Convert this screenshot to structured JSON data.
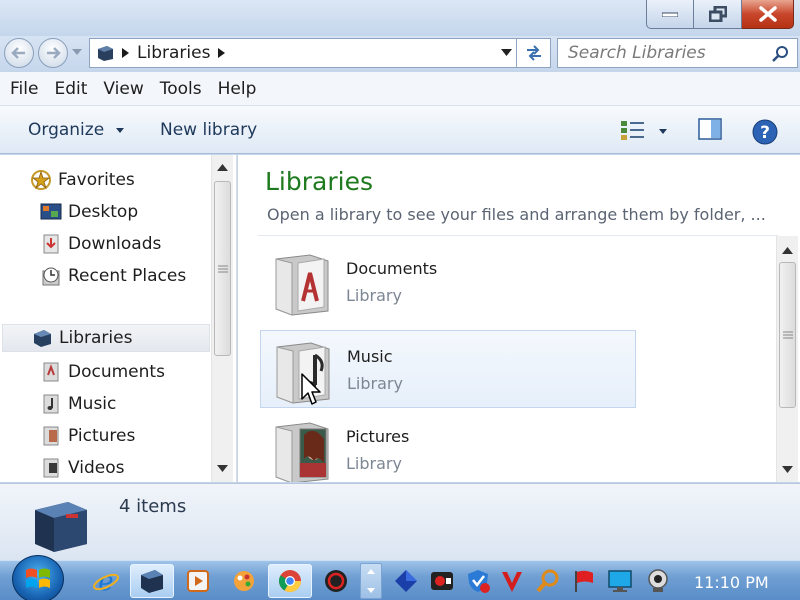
{
  "window": {
    "controls": {
      "minimize": "minimize-icon",
      "maximize": "restore-icon",
      "close": "close-icon"
    }
  },
  "address": {
    "crumb": "Libraries",
    "search_placeholder": "Search Libraries"
  },
  "menu": {
    "items": [
      "File",
      "Edit",
      "View",
      "Tools",
      "Help"
    ]
  },
  "toolbar": {
    "organize": "Organize",
    "new_library": "New library"
  },
  "nav": {
    "favorites": "Favorites",
    "favorites_items": [
      "Desktop",
      "Downloads",
      "Recent Places"
    ],
    "libraries": "Libraries",
    "libraries_items": [
      "Documents",
      "Music",
      "Pictures",
      "Videos"
    ]
  },
  "content": {
    "heading": "Libraries",
    "subtitle": "Open a library to see your files and arrange them by folder, ...",
    "items": [
      {
        "name": "Documents",
        "type": "Library"
      },
      {
        "name": "Music",
        "type": "Library"
      },
      {
        "name": "Pictures",
        "type": "Library"
      }
    ]
  },
  "details": {
    "count": "4 items"
  },
  "taskbar": {
    "clock": "11:10 PM"
  },
  "colors": {
    "heading_green": "#1e7a1e",
    "accent_blue": "#1e395b",
    "taskbar_blue": "#5a8dc8"
  }
}
